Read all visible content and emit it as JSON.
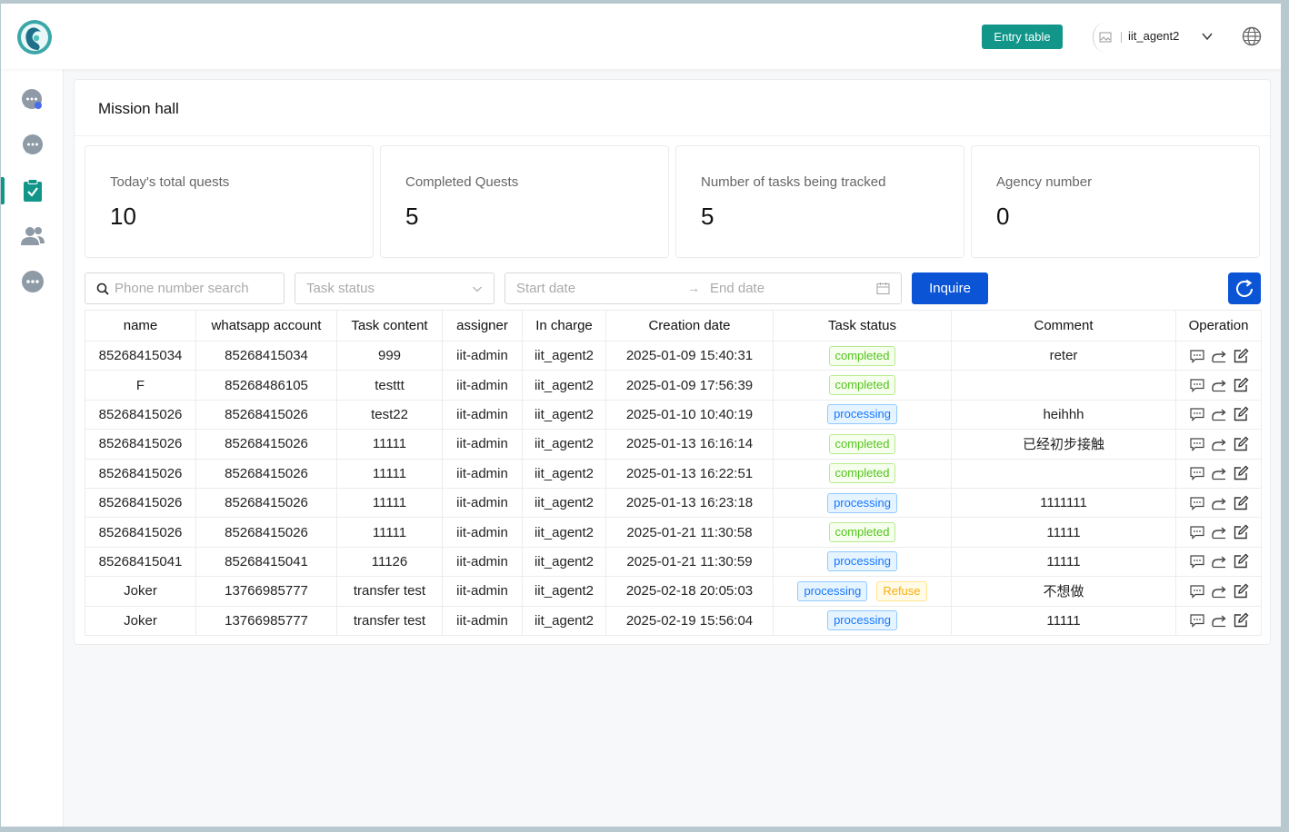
{
  "header": {
    "entry_button": "Entry table",
    "username": "iit_agent2"
  },
  "sidebar": {
    "items": [
      {
        "icon": "chat-agent-icon"
      },
      {
        "icon": "chat-bubble-icon"
      },
      {
        "icon": "task-clipboard-icon",
        "active": true
      },
      {
        "icon": "users-icon"
      },
      {
        "icon": "more-icon"
      }
    ]
  },
  "page": {
    "title": "Mission hall"
  },
  "stats": [
    {
      "label": "Today's total quests",
      "value": "10"
    },
    {
      "label": "Completed Quests",
      "value": "5"
    },
    {
      "label": "Number of tasks being tracked",
      "value": "5"
    },
    {
      "label": "Agency number",
      "value": "0"
    }
  ],
  "filters": {
    "search_placeholder": "Phone number search",
    "status_placeholder": "Task status",
    "start_date_placeholder": "Start date",
    "date_arrow": "→",
    "end_date_placeholder": "End date",
    "inquire_label": "Inquire"
  },
  "table": {
    "columns": [
      "name",
      "whatsapp account",
      "Task content",
      "assigner",
      "In charge",
      "Creation date",
      "Task status",
      "Comment",
      "Operation"
    ],
    "rows": [
      {
        "name": "85268415034",
        "account": "85268415034",
        "content": "999",
        "assigner": "iit-admin",
        "in_charge": "iit_agent2",
        "date": "2025-01-09 15:40:31",
        "status": [
          "completed"
        ],
        "comment": "reter"
      },
      {
        "name": "F",
        "account": "85268486105",
        "content": "testtt",
        "assigner": "iit-admin",
        "in_charge": "iit_agent2",
        "date": "2025-01-09 17:56:39",
        "status": [
          "completed"
        ],
        "comment": ""
      },
      {
        "name": "85268415026",
        "account": "85268415026",
        "content": "test22",
        "assigner": "iit-admin",
        "in_charge": "iit_agent2",
        "date": "2025-01-10 10:40:19",
        "status": [
          "processing"
        ],
        "comment": "heihhh"
      },
      {
        "name": "85268415026",
        "account": "85268415026",
        "content": "11111",
        "assigner": "iit-admin",
        "in_charge": "iit_agent2",
        "date": "2025-01-13 16:16:14",
        "status": [
          "completed"
        ],
        "comment": "已经初步接触"
      },
      {
        "name": "85268415026",
        "account": "85268415026",
        "content": "11111",
        "assigner": "iit-admin",
        "in_charge": "iit_agent2",
        "date": "2025-01-13 16:22:51",
        "status": [
          "completed"
        ],
        "comment": ""
      },
      {
        "name": "85268415026",
        "account": "85268415026",
        "content": "11111",
        "assigner": "iit-admin",
        "in_charge": "iit_agent2",
        "date": "2025-01-13 16:23:18",
        "status": [
          "processing"
        ],
        "comment": "1111111"
      },
      {
        "name": "85268415026",
        "account": "85268415026",
        "content": "11111",
        "assigner": "iit-admin",
        "in_charge": "iit_agent2",
        "date": "2025-01-21 11:30:58",
        "status": [
          "completed"
        ],
        "comment": "11111"
      },
      {
        "name": "85268415041",
        "account": "85268415041",
        "content": "11126",
        "assigner": "iit-admin",
        "in_charge": "iit_agent2",
        "date": "2025-01-21 11:30:59",
        "status": [
          "processing"
        ],
        "comment": "11111"
      },
      {
        "name": "Joker",
        "account": "13766985777",
        "content": "transfer test",
        "assigner": "iit-admin",
        "in_charge": "iit_agent2",
        "date": "2025-02-18 20:05:03",
        "status": [
          "processing",
          "Refuse"
        ],
        "comment": "不想做"
      },
      {
        "name": "Joker",
        "account": "13766985777",
        "content": "transfer test",
        "assigner": "iit-admin",
        "in_charge": "iit_agent2",
        "date": "2025-02-19 15:56:04",
        "status": [
          "processing"
        ],
        "comment": "11111"
      }
    ],
    "operation_icons": [
      "comment-icon",
      "transfer-icon",
      "edit-icon"
    ]
  },
  "colors": {
    "brand": "#12968a",
    "primary": "#0b54d6",
    "completed": "#52c41a",
    "processing": "#1677ff",
    "refuse": "#faad14"
  }
}
